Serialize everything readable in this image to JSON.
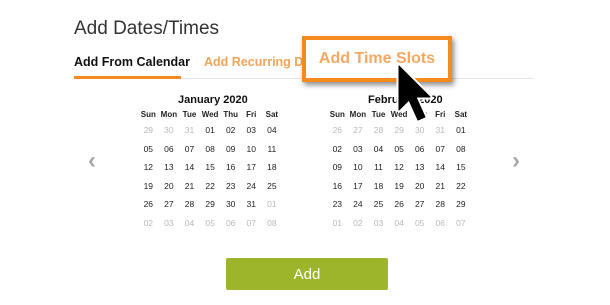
{
  "section_title": "Add Dates/Times",
  "tabs": {
    "calendar": "Add From Calendar",
    "recurring": "Add Recurring Dates",
    "time_slots": "Add Time Slots"
  },
  "accent_color": "#f58a1f",
  "button_color": "#9db52b",
  "weekday_headers": [
    "Sun",
    "Mon",
    "Tue",
    "Wed",
    "Thu",
    "Fri",
    "Sat"
  ],
  "calendars": [
    {
      "month": "January 2020",
      "weeks": [
        [
          {
            "d": "29",
            "dim": true
          },
          {
            "d": "30",
            "dim": true
          },
          {
            "d": "31",
            "dim": true
          },
          {
            "d": "01"
          },
          {
            "d": "02"
          },
          {
            "d": "03"
          },
          {
            "d": "04"
          }
        ],
        [
          {
            "d": "05"
          },
          {
            "d": "06"
          },
          {
            "d": "07"
          },
          {
            "d": "08"
          },
          {
            "d": "09"
          },
          {
            "d": "10"
          },
          {
            "d": "11"
          }
        ],
        [
          {
            "d": "12"
          },
          {
            "d": "13"
          },
          {
            "d": "14"
          },
          {
            "d": "15"
          },
          {
            "d": "16"
          },
          {
            "d": "17"
          },
          {
            "d": "18"
          }
        ],
        [
          {
            "d": "19"
          },
          {
            "d": "20"
          },
          {
            "d": "21"
          },
          {
            "d": "22"
          },
          {
            "d": "23"
          },
          {
            "d": "24"
          },
          {
            "d": "25"
          }
        ],
        [
          {
            "d": "26"
          },
          {
            "d": "27"
          },
          {
            "d": "28"
          },
          {
            "d": "29"
          },
          {
            "d": "30"
          },
          {
            "d": "31"
          },
          {
            "d": "01",
            "dim": true
          }
        ],
        [
          {
            "d": "02",
            "dim": true
          },
          {
            "d": "03",
            "dim": true
          },
          {
            "d": "04",
            "dim": true
          },
          {
            "d": "05",
            "dim": true
          },
          {
            "d": "06",
            "dim": true
          },
          {
            "d": "07",
            "dim": true
          },
          {
            "d": "08",
            "dim": true
          }
        ]
      ]
    },
    {
      "month": "February 2020",
      "weeks": [
        [
          {
            "d": "26",
            "dim": true
          },
          {
            "d": "27",
            "dim": true
          },
          {
            "d": "28",
            "dim": true
          },
          {
            "d": "29",
            "dim": true
          },
          {
            "d": "30",
            "dim": true
          },
          {
            "d": "31",
            "dim": true
          },
          {
            "d": "01"
          }
        ],
        [
          {
            "d": "02"
          },
          {
            "d": "03"
          },
          {
            "d": "04"
          },
          {
            "d": "05"
          },
          {
            "d": "06"
          },
          {
            "d": "07"
          },
          {
            "d": "08"
          }
        ],
        [
          {
            "d": "09"
          },
          {
            "d": "10"
          },
          {
            "d": "11"
          },
          {
            "d": "12"
          },
          {
            "d": "13"
          },
          {
            "d": "14"
          },
          {
            "d": "15"
          }
        ],
        [
          {
            "d": "16"
          },
          {
            "d": "17"
          },
          {
            "d": "18"
          },
          {
            "d": "19"
          },
          {
            "d": "20"
          },
          {
            "d": "21"
          },
          {
            "d": "22"
          }
        ],
        [
          {
            "d": "23"
          },
          {
            "d": "24"
          },
          {
            "d": "25"
          },
          {
            "d": "26"
          },
          {
            "d": "27"
          },
          {
            "d": "28"
          },
          {
            "d": "29"
          }
        ],
        [
          {
            "d": "01",
            "dim": true
          },
          {
            "d": "02",
            "dim": true
          },
          {
            "d": "03",
            "dim": true
          },
          {
            "d": "04",
            "dim": true
          },
          {
            "d": "05",
            "dim": true
          },
          {
            "d": "06",
            "dim": true
          },
          {
            "d": "07",
            "dim": true
          }
        ]
      ]
    }
  ],
  "nav": {
    "prev_icon": "chevron-left-icon",
    "next_icon": "chevron-right-icon",
    "prev_glyph": "‹",
    "next_glyph": "›"
  },
  "add_button_label": "Add",
  "cursor_icon": "mouse-pointer-icon"
}
